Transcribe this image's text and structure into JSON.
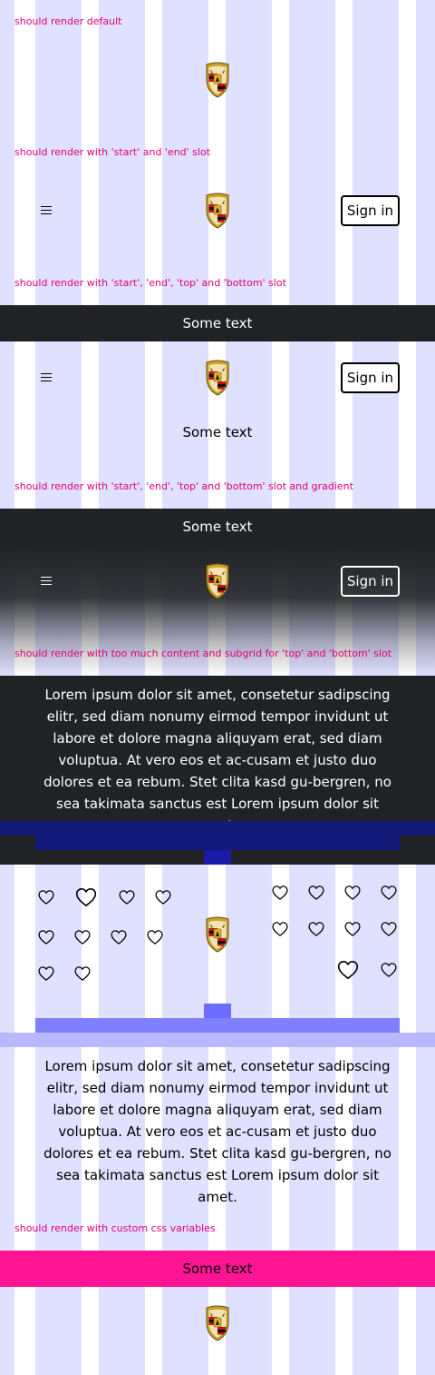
{
  "sections": {
    "default": {
      "label": "should render default"
    },
    "start_end": {
      "label": "should render with 'start' and 'end' slot",
      "sign_in": "Sign in"
    },
    "four_slots": {
      "label": "should render with 'start', 'end', 'top' and 'bottom' slot",
      "top_text": "Some text",
      "bottom_text": "Some text",
      "sign_in": "Sign in"
    },
    "gradient": {
      "label": "should render with 'start', 'end', 'top' and 'bottom' slot and gradient",
      "top_text": "Some text",
      "sign_in": "Sign in"
    },
    "subgrid": {
      "label": "should render with too much content and subgrid for 'top' and 'bottom' slot",
      "top_paragraph": "Lorem ipsum dolor sit amet, consetetur sadipscing elitr, sed diam nonumy eirmod tempor invidunt ut labore et dolore magna aliquyam erat, sed diam voluptua. At vero eos et ac-cusam et justo duo dolores et ea rebum. Stet clita kasd gu-bergren, no sea takimata sanctus est Lorem ipsum dolor sit amet.",
      "bottom_paragraph": "Lorem ipsum dolor sit amet, consetetur sadipscing elitr, sed diam nonumy eirmod tempor invidunt ut labore et dolore magna aliquyam erat, sed diam voluptua. At vero eos et ac-cusam et justo duo dolores et ea rebum. Stet clita kasd gu-bergren, no sea takimata sanctus est Lorem ipsum dolor sit amet."
    },
    "custom_css": {
      "label": "should render with custom css variables",
      "top_text": "Some text"
    }
  },
  "icons": {
    "crest": "porsche-crest-icon",
    "menu": "hamburger-menu-icon",
    "heart": "heart-icon"
  },
  "colors": {
    "label": "#e1007a",
    "dark_bar": "#212225",
    "pink_bar": "#ff1493",
    "grid_column": "#e0e0ff",
    "subgrid_dark": "#141a7a",
    "subgrid_light": "#8080ff"
  }
}
